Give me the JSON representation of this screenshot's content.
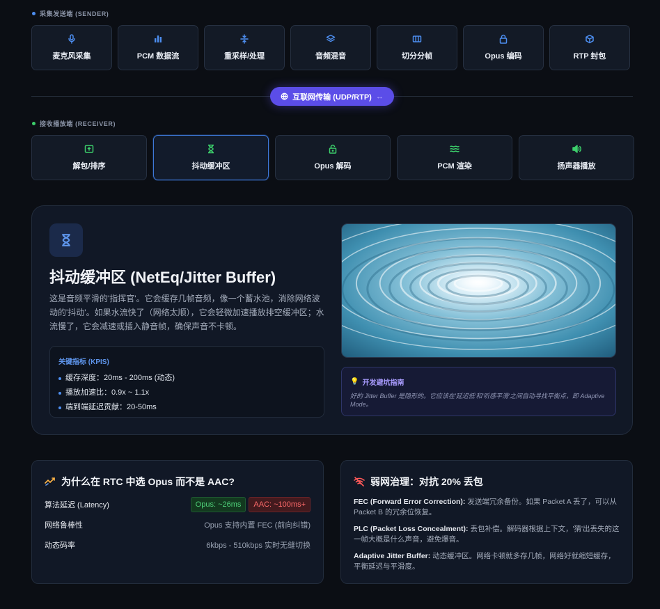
{
  "sender": {
    "label": "采集发送端 (SENDER)",
    "dot_color": "#4d8ef0",
    "steps": [
      {
        "label": "麦克风采集",
        "icon": "mic-icon"
      },
      {
        "label": "PCM 数据流",
        "icon": "bar-chart-icon"
      },
      {
        "label": "重采样/处理",
        "icon": "resample-icon"
      },
      {
        "label": "音频混音",
        "icon": "layers-icon"
      },
      {
        "label": "切分分帧",
        "icon": "columns-icon"
      },
      {
        "label": "Opus 编码",
        "icon": "lock-icon"
      },
      {
        "label": "RTP 封包",
        "icon": "cube-icon"
      }
    ]
  },
  "network": {
    "label": "互联网传输 (UDP/RTP)",
    "icon": "globe-icon"
  },
  "receiver": {
    "label": "接收播放端 (RECEIVER)",
    "dot_color": "#3ccf6b",
    "steps": [
      {
        "label": "解包/排序",
        "icon": "unpack-icon"
      },
      {
        "label": "抖动缓冲区",
        "icon": "hourglass-icon",
        "active": true
      },
      {
        "label": "Opus 解码",
        "icon": "unlock-icon"
      },
      {
        "label": "PCM 渲染",
        "icon": "waves-icon"
      },
      {
        "label": "扬声器播放",
        "icon": "speaker-icon"
      }
    ]
  },
  "detail": {
    "title": "抖动缓冲区 (NetEq/Jitter Buffer)",
    "description": "这是音频平滑的'指挥官'。它会缓存几帧音频，像一个蓄水池，消除网络波动的'抖动'。如果水流快了（网络太顺），它会轻微加速播放排空缓冲区；水流慢了，它会减速或插入静音帧，确保声音不卡顿。",
    "kpi_title": "关键指标 (KPIS)",
    "kpis": [
      "缓存深度：20ms - 200ms (动态)",
      "播放加速比：0.9x ~ 1.1x",
      "端到端延迟贡献：20-50ms"
    ],
    "tip_title": "开发避坑指南",
    "tip_text": "好的 Jitter Buffer 是隐形的。它应该在'延迟低'和'听感平滑'之间自动寻找平衡点，即 Adaptive Mode。"
  },
  "opus_card": {
    "title": "为什么在 RTC 中选 Opus 而不是 AAC?",
    "rows": [
      {
        "label": "算法延迟 (Latency)",
        "badge_opus": "Opus: ~26ms",
        "badge_aac": "AAC: ~100ms+"
      },
      {
        "label": "网络鲁棒性",
        "value": "Opus 支持内置 FEC (前向纠错)"
      },
      {
        "label": "动态码率",
        "value": "6kbps - 510kbps 实时无缝切换"
      }
    ]
  },
  "weak_card": {
    "title": "弱网治理：对抗 20% 丢包",
    "items": [
      {
        "term": "FEC (Forward Error Correction):",
        "text": " 发送端冗余备份。如果 Packet A 丢了，可以从 Packet B 的冗余位恢复。"
      },
      {
        "term": "PLC (Packet Loss Concealment):",
        "text": " 丢包补偿。解码器根据上下文，'猜'出丢失的这一帧大概是什么声音，避免爆音。"
      },
      {
        "term": "Adaptive Jitter Buffer:",
        "text": " 动态缓冲区。网络卡顿就多存几帧，网络好就缩短缓存，平衡延迟与平滑度。"
      }
    ]
  }
}
